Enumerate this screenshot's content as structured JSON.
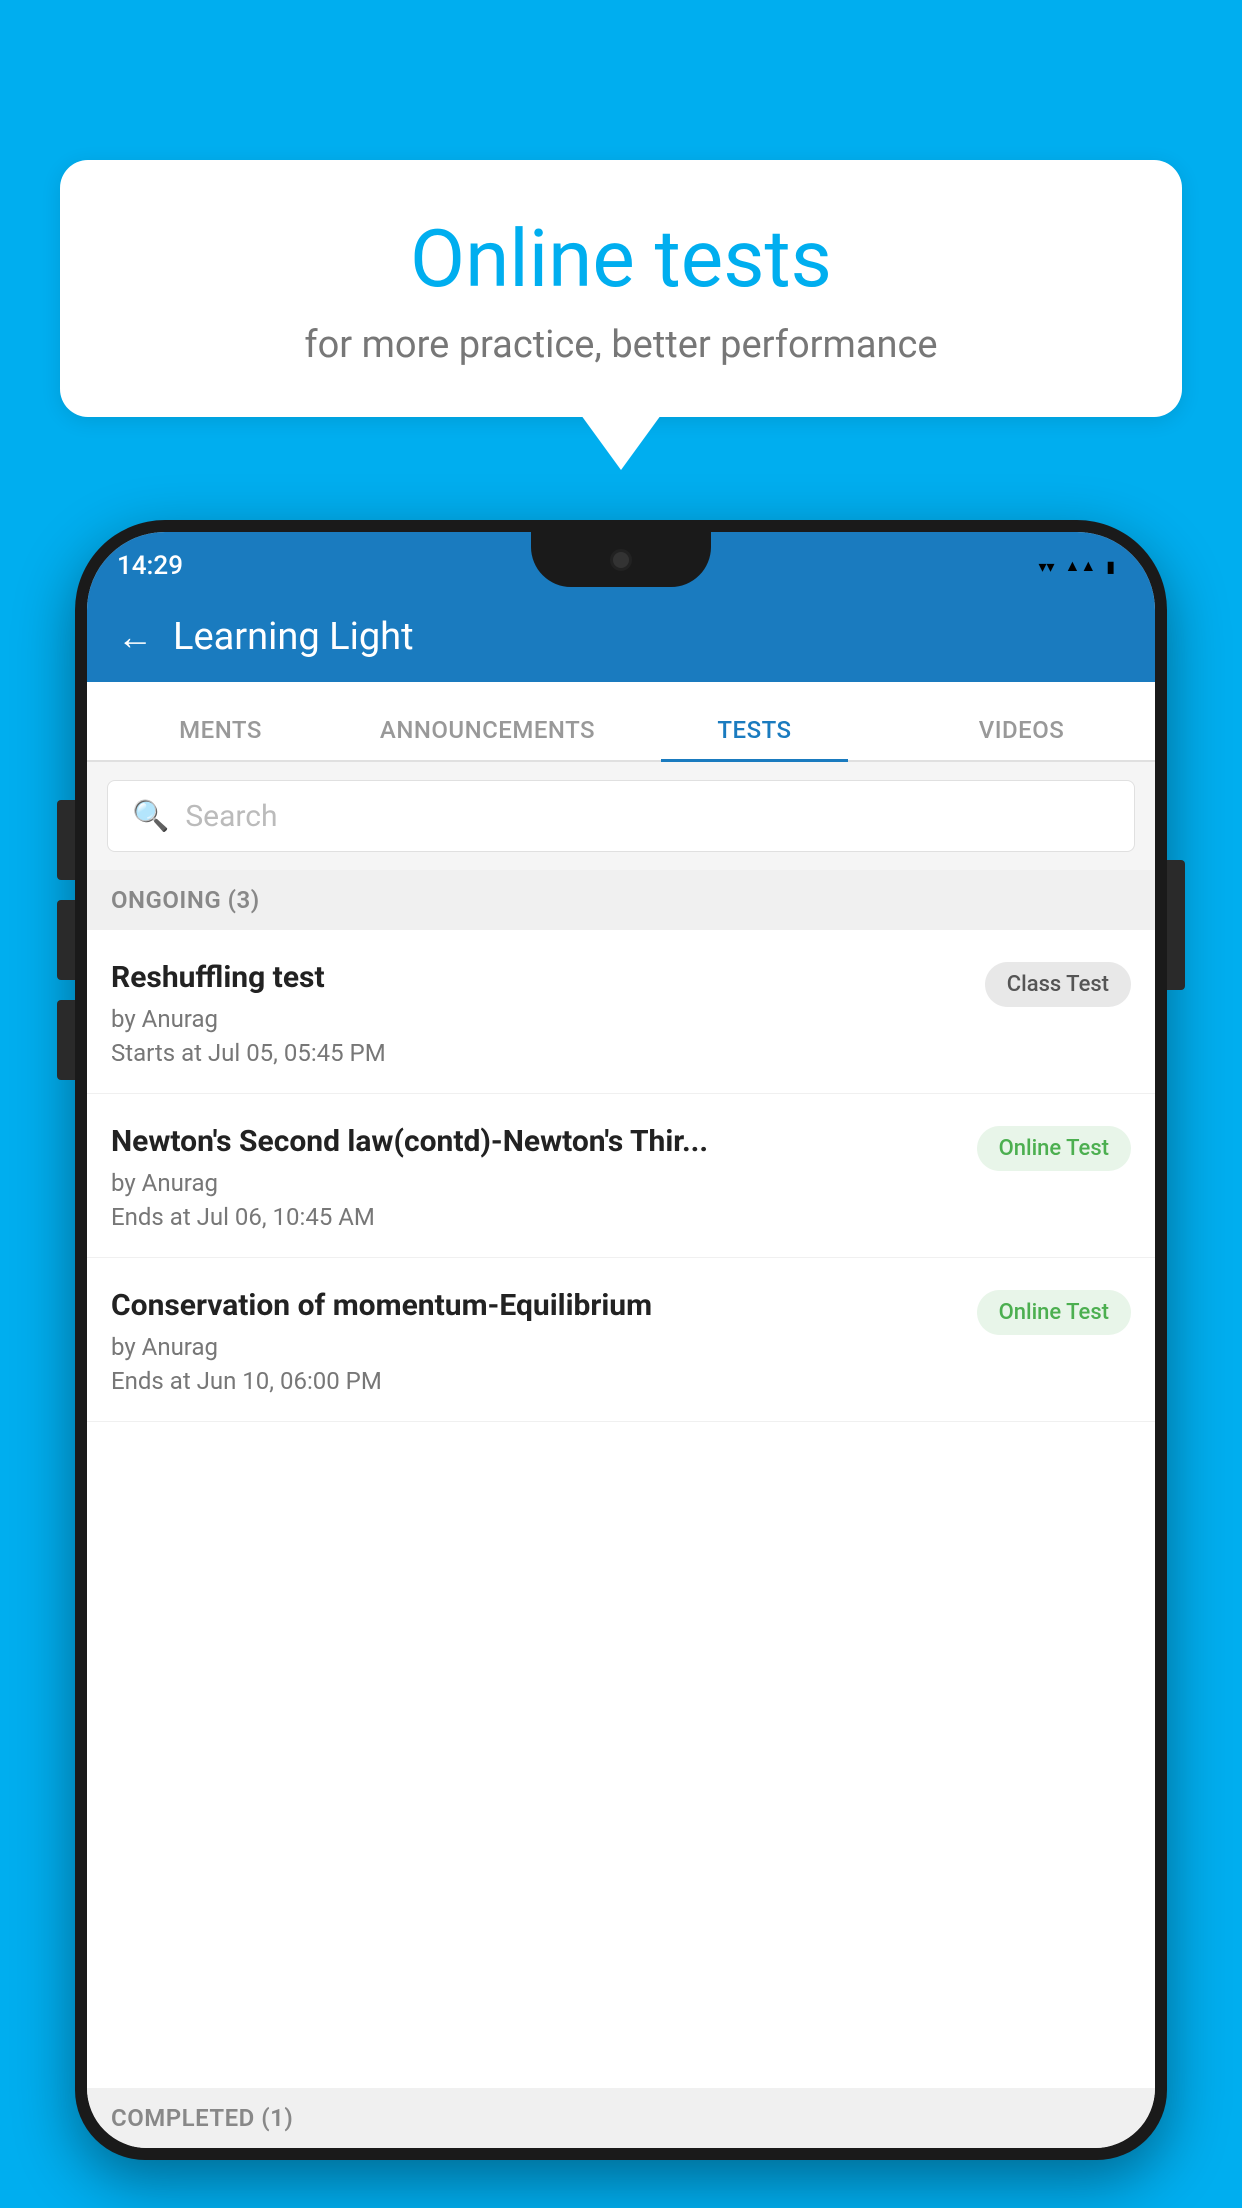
{
  "background_color": "#00AEEF",
  "speech_bubble": {
    "title": "Online tests",
    "subtitle": "for more practice, better performance"
  },
  "status_bar": {
    "time": "14:29",
    "wifi_icon": "▼",
    "signal_icon": "◀",
    "battery_icon": "▮"
  },
  "header": {
    "back_label": "←",
    "title": "Learning Light"
  },
  "tabs": [
    {
      "label": "MENTS",
      "active": false
    },
    {
      "label": "ANNOUNCEMENTS",
      "active": false
    },
    {
      "label": "TESTS",
      "active": true
    },
    {
      "label": "VIDEOS",
      "active": false
    }
  ],
  "search": {
    "placeholder": "Search",
    "icon": "🔍"
  },
  "ongoing_section": {
    "label": "ONGOING (3)"
  },
  "tests": [
    {
      "name": "Reshuffling test",
      "author": "by Anurag",
      "date": "Starts at  Jul 05, 05:45 PM",
      "badge": "Class Test",
      "badge_type": "class"
    },
    {
      "name": "Newton's Second law(contd)-Newton's Thir...",
      "author": "by Anurag",
      "date": "Ends at  Jul 06, 10:45 AM",
      "badge": "Online Test",
      "badge_type": "online"
    },
    {
      "name": "Conservation of momentum-Equilibrium",
      "author": "by Anurag",
      "date": "Ends at  Jun 10, 06:00 PM",
      "badge": "Online Test",
      "badge_type": "online"
    }
  ],
  "completed_section": {
    "label": "COMPLETED (1)"
  }
}
